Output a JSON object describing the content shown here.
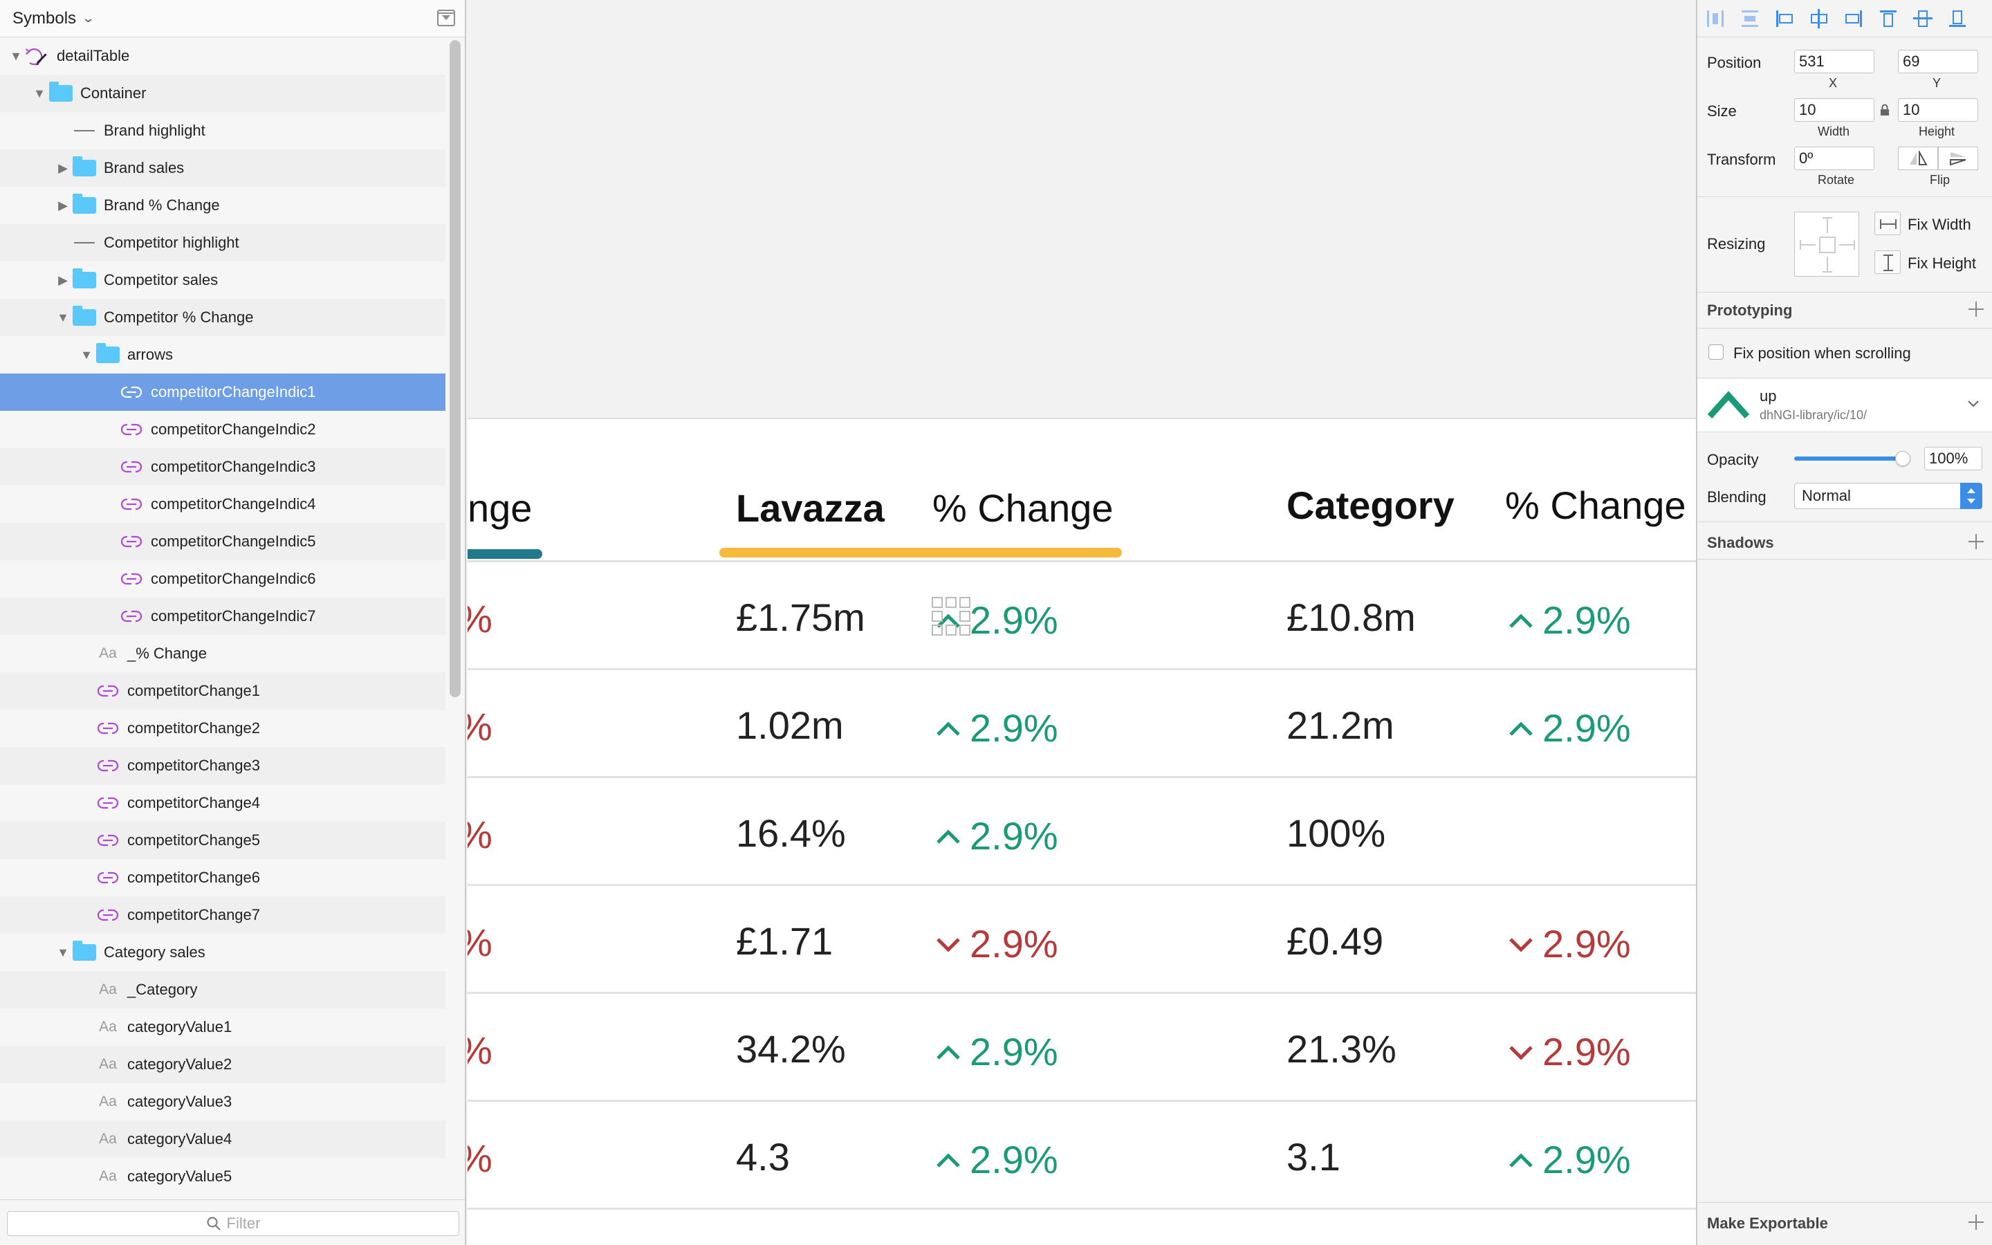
{
  "layers_panel": {
    "title": "Symbols",
    "filter_placeholder": "Filter",
    "rows": [
      {
        "label": "detailTable",
        "icon": "symbol-master-icon",
        "indent": 0,
        "toggle": "open"
      },
      {
        "label": "Container",
        "icon": "folder-icon",
        "indent": 1,
        "toggle": "open"
      },
      {
        "label": "Brand highlight",
        "icon": "line-icon",
        "indent": 2,
        "toggle": "none"
      },
      {
        "label": "Brand sales",
        "icon": "folder-icon",
        "indent": 2,
        "toggle": "closed"
      },
      {
        "label": "Brand % Change",
        "icon": "folder-icon",
        "indent": 2,
        "toggle": "closed"
      },
      {
        "label": "Competitor highlight",
        "icon": "line-icon",
        "indent": 2,
        "toggle": "none"
      },
      {
        "label": "Competitor sales",
        "icon": "folder-icon",
        "indent": 2,
        "toggle": "closed"
      },
      {
        "label": "Competitor % Change",
        "icon": "folder-icon",
        "indent": 2,
        "toggle": "open"
      },
      {
        "label": "arrows",
        "icon": "folder-icon",
        "indent": 3,
        "toggle": "open"
      },
      {
        "label": "competitorChangeIndic1",
        "icon": "symbol-instance-icon",
        "indent": 4,
        "toggle": "none",
        "selected": true
      },
      {
        "label": "competitorChangeIndic2",
        "icon": "symbol-instance-icon",
        "indent": 4,
        "toggle": "none"
      },
      {
        "label": "competitorChangeIndic3",
        "icon": "symbol-instance-icon",
        "indent": 4,
        "toggle": "none"
      },
      {
        "label": "competitorChangeIndic4",
        "icon": "symbol-instance-icon",
        "indent": 4,
        "toggle": "none"
      },
      {
        "label": "competitorChangeIndic5",
        "icon": "symbol-instance-icon",
        "indent": 4,
        "toggle": "none"
      },
      {
        "label": "competitorChangeIndic6",
        "icon": "symbol-instance-icon",
        "indent": 4,
        "toggle": "none"
      },
      {
        "label": "competitorChangeIndic7",
        "icon": "symbol-instance-icon",
        "indent": 4,
        "toggle": "none"
      },
      {
        "label": "_% Change",
        "icon": "text-icon",
        "indent": 3,
        "toggle": "none"
      },
      {
        "label": "competitorChange1",
        "icon": "symbol-instance-icon",
        "indent": 3,
        "toggle": "none"
      },
      {
        "label": "competitorChange2",
        "icon": "symbol-instance-icon",
        "indent": 3,
        "toggle": "none"
      },
      {
        "label": "competitorChange3",
        "icon": "symbol-instance-icon",
        "indent": 3,
        "toggle": "none"
      },
      {
        "label": "competitorChange4",
        "icon": "symbol-instance-icon",
        "indent": 3,
        "toggle": "none"
      },
      {
        "label": "competitorChange5",
        "icon": "symbol-instance-icon",
        "indent": 3,
        "toggle": "none"
      },
      {
        "label": "competitorChange6",
        "icon": "symbol-instance-icon",
        "indent": 3,
        "toggle": "none"
      },
      {
        "label": "competitorChange7",
        "icon": "symbol-instance-icon",
        "indent": 3,
        "toggle": "none"
      },
      {
        "label": "Category sales",
        "icon": "folder-icon",
        "indent": 2,
        "toggle": "open"
      },
      {
        "label": "_Category",
        "icon": "text-icon",
        "indent": 3,
        "toggle": "none"
      },
      {
        "label": "categoryValue1",
        "icon": "text-icon",
        "indent": 3,
        "toggle": "none"
      },
      {
        "label": "categoryValue2",
        "icon": "text-icon",
        "indent": 3,
        "toggle": "none"
      },
      {
        "label": "categoryValue3",
        "icon": "text-icon",
        "indent": 3,
        "toggle": "none"
      },
      {
        "label": "categoryValue4",
        "icon": "text-icon",
        "indent": 3,
        "toggle": "none"
      },
      {
        "label": "categoryValue5",
        "icon": "text-icon",
        "indent": 3,
        "toggle": "none"
      }
    ]
  },
  "canvas": {
    "headers": {
      "partial_change": "nge",
      "brand": "Lavazza",
      "brand_change": "% Change",
      "category": "Category",
      "category_change": "% Change"
    },
    "rows": [
      {
        "brand": "£1.75m",
        "brand_change": "2.9%",
        "brand_dir": "up",
        "category": "£10.8m",
        "category_change": "2.9%",
        "category_dir": "up"
      },
      {
        "brand": "1.02m",
        "brand_change": "2.9%",
        "brand_dir": "up",
        "category": "21.2m",
        "category_change": "2.9%",
        "category_dir": "up"
      },
      {
        "brand": "16.4%",
        "brand_change": "2.9%",
        "brand_dir": "up",
        "category": "100%",
        "category_change": "",
        "category_dir": "none"
      },
      {
        "brand": "£1.71",
        "brand_change": "2.9%",
        "brand_dir": "down",
        "category": "£0.49",
        "category_change": "2.9%",
        "category_dir": "down"
      },
      {
        "brand": "34.2%",
        "brand_change": "2.9%",
        "brand_dir": "up",
        "category": "21.3%",
        "category_change": "2.9%",
        "category_dir": "down"
      },
      {
        "brand": "4.3",
        "brand_change": "2.9%",
        "brand_dir": "up",
        "category": "3.1",
        "category_change": "2.9%",
        "category_dir": "up"
      }
    ],
    "colors": {
      "up": "#1a9a76",
      "down": "#b63a3a",
      "brand_bar": "#f6b93b",
      "competitor_bar": "#1f7a8c"
    }
  },
  "inspector": {
    "position_label": "Position",
    "x_value": "531",
    "x_label": "X",
    "y_value": "69",
    "y_label": "Y",
    "size_label": "Size",
    "width_value": "10",
    "width_label": "Width",
    "height_value": "10",
    "height_label": "Height",
    "transform_label": "Transform",
    "rotate_value": "0º",
    "rotate_label": "Rotate",
    "flip_label": "Flip",
    "resizing_label": "Resizing",
    "fix_width_label": "Fix Width",
    "fix_height_label": "Fix Height",
    "prototyping_label": "Prototyping",
    "fix_scroll_label": "Fix position when scrolling",
    "symbol_name": "up",
    "symbol_path": "dhNGI-library/ic/10/",
    "opacity_label": "Opacity",
    "opacity_value": "100%",
    "blending_label": "Blending",
    "blending_value": "Normal",
    "shadows_label": "Shadows",
    "exportable_label": "Make Exportable"
  }
}
